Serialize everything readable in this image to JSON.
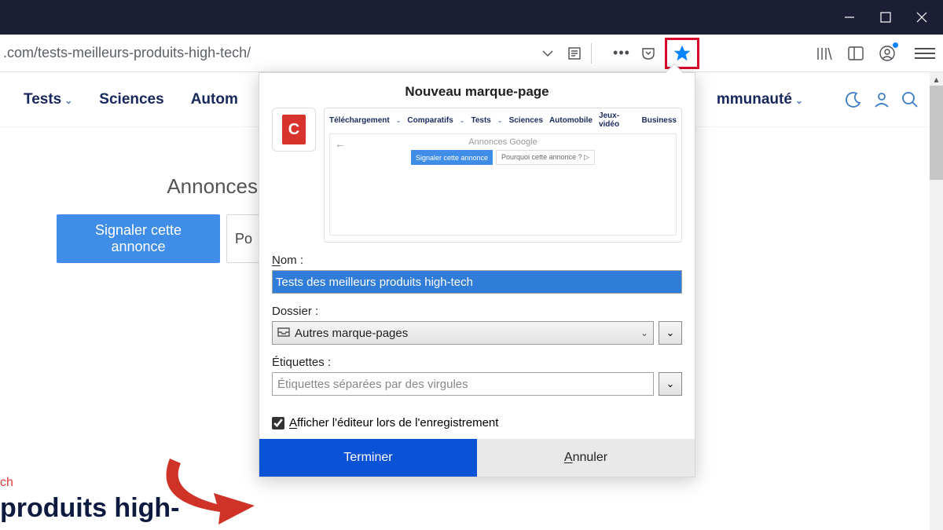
{
  "window": {},
  "url": ".com/tests-meilleurs-produits-high-tech/",
  "nav": {
    "items": [
      "Tests",
      "Sciences",
      "Autom"
    ],
    "right_item": "mmunauté"
  },
  "page": {
    "ad_label": "Annonces",
    "ad_signal": "Signaler cette annonce",
    "ad_why_short": "Po",
    "cat_snippet": "ch",
    "head_snippet": "produits high-"
  },
  "popup": {
    "title": "Nouveau marque-page",
    "preview_nav": [
      "Téléchargement",
      "Comparatifs",
      "Tests",
      "Sciences",
      "Automobile",
      "Jeux-vidéo",
      "Business"
    ],
    "preview_google": "Annonces Google",
    "preview_signal": "Signaler cette annonce",
    "preview_why": "Pourquoi cette annonce ? ▷",
    "name_label_u": "N",
    "name_label_rest": "om :",
    "name_value": "Tests des meilleurs produits high-tech",
    "folder_label": "Dossier :",
    "folder_value": "Autres marque-pages",
    "tags_label": "Étiquettes :",
    "tags_placeholder": "Étiquettes séparées par des virgules",
    "show_editor_u": "A",
    "show_editor_rest": "fficher l'éditeur lors de l'enregistrement",
    "done": "Terminer",
    "cancel_u": "A",
    "cancel_rest": "nnuler"
  }
}
